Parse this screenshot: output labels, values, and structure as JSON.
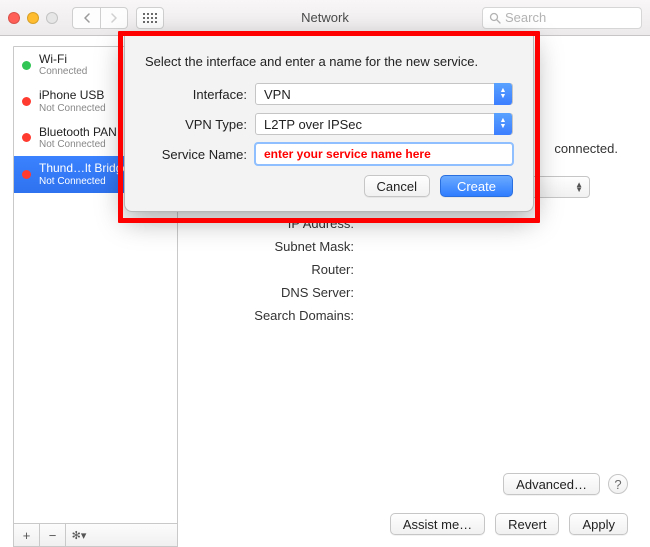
{
  "titlebar": {
    "title": "Network",
    "search_placeholder": "Search"
  },
  "sidebar": {
    "items": [
      {
        "name": "Wi-Fi",
        "status": "Connected",
        "dot": "green"
      },
      {
        "name": "iPhone USB",
        "status": "Not Connected",
        "dot": "red"
      },
      {
        "name": "Bluetooth PAN",
        "status": "Not Connected",
        "dot": "red"
      },
      {
        "name": "Thund…lt Bridge",
        "status": "Not Connected",
        "dot": "red",
        "selected": true
      }
    ],
    "footer": {
      "add": "+",
      "remove": "−",
      "gear": "✻▾"
    }
  },
  "main": {
    "connected_fragment": "connected.",
    "labels": {
      "ip": "IP Address:",
      "subnet": "Subnet Mask:",
      "router": "Router:",
      "dns": "DNS Server:",
      "search_domains": "Search Domains:"
    },
    "advanced": "Advanced…",
    "help": "?",
    "assist": "Assist me…",
    "revert": "Revert",
    "apply": "Apply"
  },
  "sheet": {
    "title": "Select the interface and enter a name for the new service.",
    "labels": {
      "interface": "Interface:",
      "vpn_type": "VPN Type:",
      "service_name": "Service Name:"
    },
    "interface_value": "VPN",
    "vpn_type_value": "L2TP over IPSec",
    "service_name_value": "enter your service name here",
    "cancel": "Cancel",
    "create": "Create"
  }
}
